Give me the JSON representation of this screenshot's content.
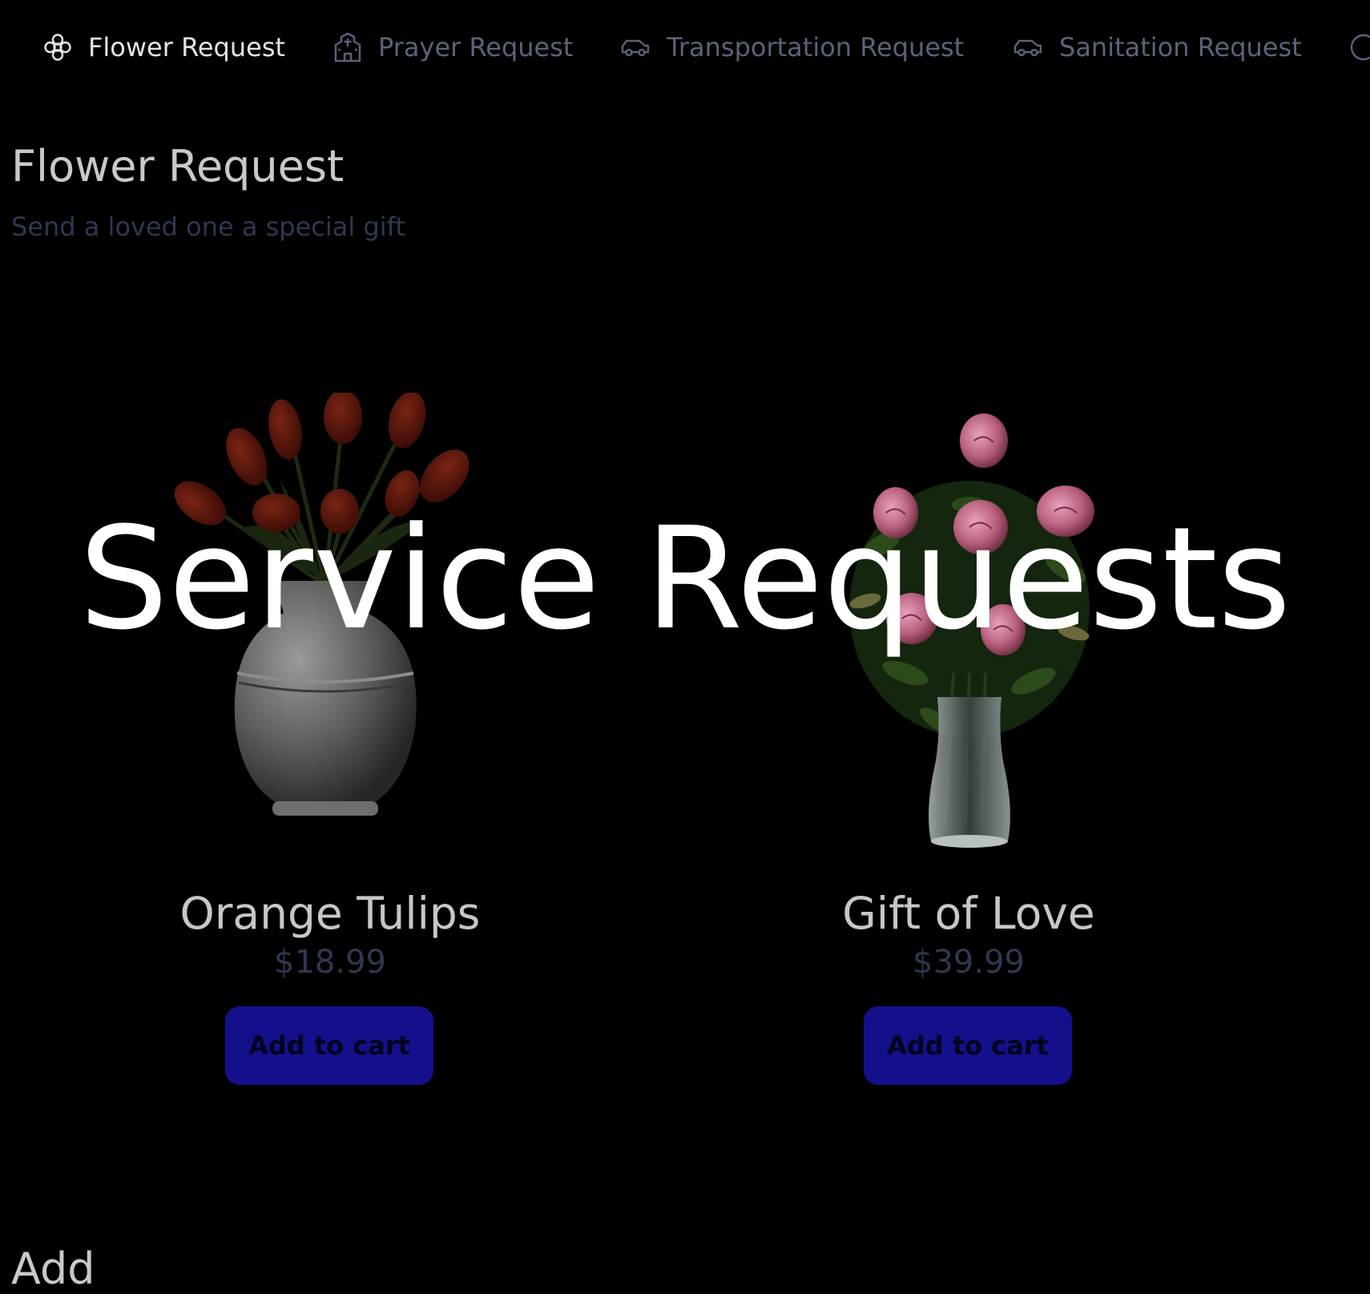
{
  "tabs": [
    {
      "label": "Flower Request",
      "icon": "flower-icon",
      "active": true
    },
    {
      "label": "Prayer Request",
      "icon": "chapel-icon",
      "active": false
    },
    {
      "label": "Transportation Request",
      "icon": "car-icon",
      "active": false
    },
    {
      "label": "Sanitation Request",
      "icon": "car-icon",
      "active": false
    }
  ],
  "page": {
    "title": "Flower Request",
    "subtitle": "Send a loved one a special gift"
  },
  "products": [
    {
      "name": "Orange Tulips",
      "price": "$18.99",
      "button_label": "Add to cart",
      "image": "tulips-in-vase-image"
    },
    {
      "name": "Gift of Love",
      "price": "$39.99",
      "button_label": "Add to cart",
      "image": "roses-in-vase-image"
    }
  ],
  "next_section": {
    "title_fragment": "Add"
  },
  "overlay": {
    "title": "Service Requests"
  },
  "colors": {
    "background": "#000000",
    "active_tab": "#e4e4e4",
    "inactive_tab": "#5c6278",
    "button": "#14108c",
    "button_text": "#04031e",
    "price_text": "#2f3850"
  }
}
